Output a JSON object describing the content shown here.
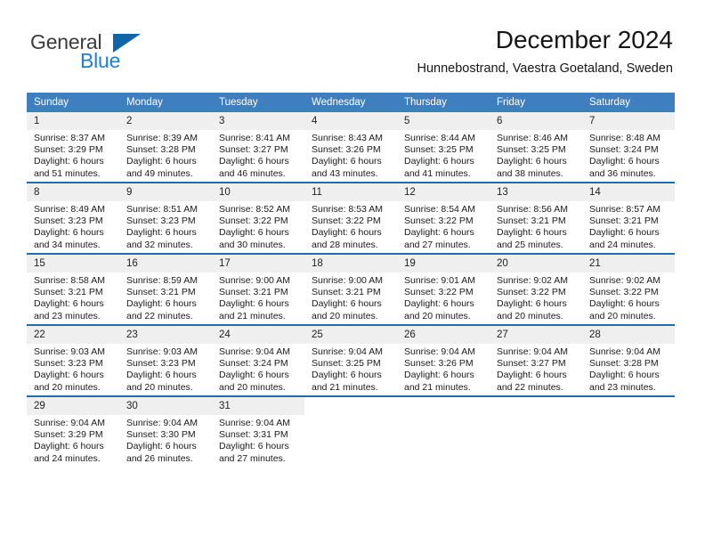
{
  "brand": {
    "name_part1": "General",
    "name_part2": "Blue",
    "accent_color": "#1064a8",
    "blue_text_color": "#1f7fd0"
  },
  "header": {
    "title": "December 2024",
    "subtitle": "Hunnebostrand, Vaestra Goetaland, Sweden"
  },
  "theme": {
    "header_row_bg": "#3f7fbf",
    "row_divider": "#1d6bb0",
    "daynum_bg": "#efefef"
  },
  "weekdays": [
    "Sunday",
    "Monday",
    "Tuesday",
    "Wednesday",
    "Thursday",
    "Friday",
    "Saturday"
  ],
  "labels": {
    "sunrise_prefix": "Sunrise:",
    "sunset_prefix": "Sunset:",
    "daylight_prefix": "Daylight:"
  },
  "weeks": [
    [
      {
        "day": "1",
        "sunrise": "Sunrise: 8:37 AM",
        "sunset": "Sunset: 3:29 PM",
        "daylight1": "Daylight: 6 hours",
        "daylight2": "and 51 minutes."
      },
      {
        "day": "2",
        "sunrise": "Sunrise: 8:39 AM",
        "sunset": "Sunset: 3:28 PM",
        "daylight1": "Daylight: 6 hours",
        "daylight2": "and 49 minutes."
      },
      {
        "day": "3",
        "sunrise": "Sunrise: 8:41 AM",
        "sunset": "Sunset: 3:27 PM",
        "daylight1": "Daylight: 6 hours",
        "daylight2": "and 46 minutes."
      },
      {
        "day": "4",
        "sunrise": "Sunrise: 8:43 AM",
        "sunset": "Sunset: 3:26 PM",
        "daylight1": "Daylight: 6 hours",
        "daylight2": "and 43 minutes."
      },
      {
        "day": "5",
        "sunrise": "Sunrise: 8:44 AM",
        "sunset": "Sunset: 3:25 PM",
        "daylight1": "Daylight: 6 hours",
        "daylight2": "and 41 minutes."
      },
      {
        "day": "6",
        "sunrise": "Sunrise: 8:46 AM",
        "sunset": "Sunset: 3:25 PM",
        "daylight1": "Daylight: 6 hours",
        "daylight2": "and 38 minutes."
      },
      {
        "day": "7",
        "sunrise": "Sunrise: 8:48 AM",
        "sunset": "Sunset: 3:24 PM",
        "daylight1": "Daylight: 6 hours",
        "daylight2": "and 36 minutes."
      }
    ],
    [
      {
        "day": "8",
        "sunrise": "Sunrise: 8:49 AM",
        "sunset": "Sunset: 3:23 PM",
        "daylight1": "Daylight: 6 hours",
        "daylight2": "and 34 minutes."
      },
      {
        "day": "9",
        "sunrise": "Sunrise: 8:51 AM",
        "sunset": "Sunset: 3:23 PM",
        "daylight1": "Daylight: 6 hours",
        "daylight2": "and 32 minutes."
      },
      {
        "day": "10",
        "sunrise": "Sunrise: 8:52 AM",
        "sunset": "Sunset: 3:22 PM",
        "daylight1": "Daylight: 6 hours",
        "daylight2": "and 30 minutes."
      },
      {
        "day": "11",
        "sunrise": "Sunrise: 8:53 AM",
        "sunset": "Sunset: 3:22 PM",
        "daylight1": "Daylight: 6 hours",
        "daylight2": "and 28 minutes."
      },
      {
        "day": "12",
        "sunrise": "Sunrise: 8:54 AM",
        "sunset": "Sunset: 3:22 PM",
        "daylight1": "Daylight: 6 hours",
        "daylight2": "and 27 minutes."
      },
      {
        "day": "13",
        "sunrise": "Sunrise: 8:56 AM",
        "sunset": "Sunset: 3:21 PM",
        "daylight1": "Daylight: 6 hours",
        "daylight2": "and 25 minutes."
      },
      {
        "day": "14",
        "sunrise": "Sunrise: 8:57 AM",
        "sunset": "Sunset: 3:21 PM",
        "daylight1": "Daylight: 6 hours",
        "daylight2": "and 24 minutes."
      }
    ],
    [
      {
        "day": "15",
        "sunrise": "Sunrise: 8:58 AM",
        "sunset": "Sunset: 3:21 PM",
        "daylight1": "Daylight: 6 hours",
        "daylight2": "and 23 minutes."
      },
      {
        "day": "16",
        "sunrise": "Sunrise: 8:59 AM",
        "sunset": "Sunset: 3:21 PM",
        "daylight1": "Daylight: 6 hours",
        "daylight2": "and 22 minutes."
      },
      {
        "day": "17",
        "sunrise": "Sunrise: 9:00 AM",
        "sunset": "Sunset: 3:21 PM",
        "daylight1": "Daylight: 6 hours",
        "daylight2": "and 21 minutes."
      },
      {
        "day": "18",
        "sunrise": "Sunrise: 9:00 AM",
        "sunset": "Sunset: 3:21 PM",
        "daylight1": "Daylight: 6 hours",
        "daylight2": "and 20 minutes."
      },
      {
        "day": "19",
        "sunrise": "Sunrise: 9:01 AM",
        "sunset": "Sunset: 3:22 PM",
        "daylight1": "Daylight: 6 hours",
        "daylight2": "and 20 minutes."
      },
      {
        "day": "20",
        "sunrise": "Sunrise: 9:02 AM",
        "sunset": "Sunset: 3:22 PM",
        "daylight1": "Daylight: 6 hours",
        "daylight2": "and 20 minutes."
      },
      {
        "day": "21",
        "sunrise": "Sunrise: 9:02 AM",
        "sunset": "Sunset: 3:22 PM",
        "daylight1": "Daylight: 6 hours",
        "daylight2": "and 20 minutes."
      }
    ],
    [
      {
        "day": "22",
        "sunrise": "Sunrise: 9:03 AM",
        "sunset": "Sunset: 3:23 PM",
        "daylight1": "Daylight: 6 hours",
        "daylight2": "and 20 minutes."
      },
      {
        "day": "23",
        "sunrise": "Sunrise: 9:03 AM",
        "sunset": "Sunset: 3:23 PM",
        "daylight1": "Daylight: 6 hours",
        "daylight2": "and 20 minutes."
      },
      {
        "day": "24",
        "sunrise": "Sunrise: 9:04 AM",
        "sunset": "Sunset: 3:24 PM",
        "daylight1": "Daylight: 6 hours",
        "daylight2": "and 20 minutes."
      },
      {
        "day": "25",
        "sunrise": "Sunrise: 9:04 AM",
        "sunset": "Sunset: 3:25 PM",
        "daylight1": "Daylight: 6 hours",
        "daylight2": "and 21 minutes."
      },
      {
        "day": "26",
        "sunrise": "Sunrise: 9:04 AM",
        "sunset": "Sunset: 3:26 PM",
        "daylight1": "Daylight: 6 hours",
        "daylight2": "and 21 minutes."
      },
      {
        "day": "27",
        "sunrise": "Sunrise: 9:04 AM",
        "sunset": "Sunset: 3:27 PM",
        "daylight1": "Daylight: 6 hours",
        "daylight2": "and 22 minutes."
      },
      {
        "day": "28",
        "sunrise": "Sunrise: 9:04 AM",
        "sunset": "Sunset: 3:28 PM",
        "daylight1": "Daylight: 6 hours",
        "daylight2": "and 23 minutes."
      }
    ],
    [
      {
        "day": "29",
        "sunrise": "Sunrise: 9:04 AM",
        "sunset": "Sunset: 3:29 PM",
        "daylight1": "Daylight: 6 hours",
        "daylight2": "and 24 minutes."
      },
      {
        "day": "30",
        "sunrise": "Sunrise: 9:04 AM",
        "sunset": "Sunset: 3:30 PM",
        "daylight1": "Daylight: 6 hours",
        "daylight2": "and 26 minutes."
      },
      {
        "day": "31",
        "sunrise": "Sunrise: 9:04 AM",
        "sunset": "Sunset: 3:31 PM",
        "daylight1": "Daylight: 6 hours",
        "daylight2": "and 27 minutes."
      },
      {
        "day": "",
        "sunrise": "",
        "sunset": "",
        "daylight1": "",
        "daylight2": ""
      },
      {
        "day": "",
        "sunrise": "",
        "sunset": "",
        "daylight1": "",
        "daylight2": ""
      },
      {
        "day": "",
        "sunrise": "",
        "sunset": "",
        "daylight1": "",
        "daylight2": ""
      },
      {
        "day": "",
        "sunrise": "",
        "sunset": "",
        "daylight1": "",
        "daylight2": ""
      }
    ]
  ]
}
